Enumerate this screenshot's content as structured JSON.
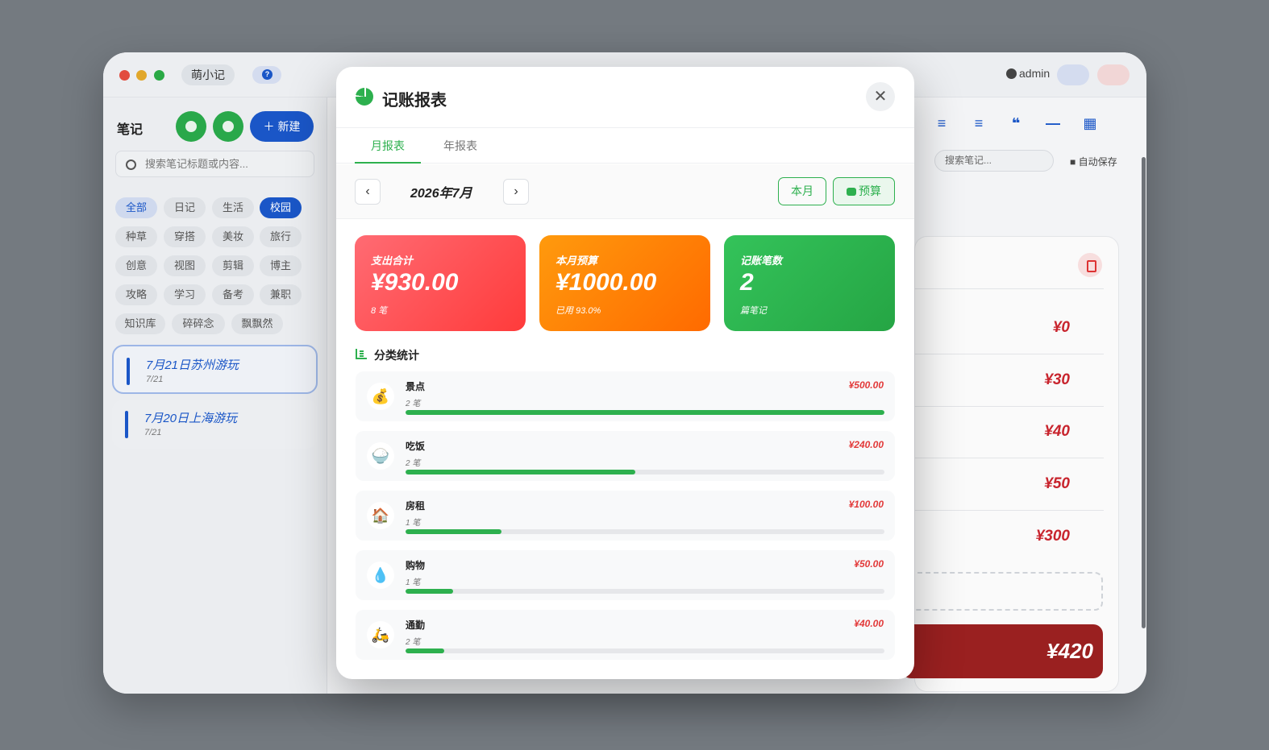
{
  "app": {
    "title": "萌小记",
    "help_icon": "help-icon",
    "user": "admin",
    "colors": {
      "primary": "#1a56c7",
      "green": "#2db04e",
      "red": "#c8242d"
    }
  },
  "sidebar": {
    "title": "笔记",
    "new_label": "新建",
    "search_placeholder": "搜索笔记标题或内容...",
    "tags": [
      "全部",
      "日记",
      "生活",
      "校园",
      "种草",
      "穿搭",
      "美妆",
      "旅行",
      "创意",
      "视图",
      "剪辑",
      "博主",
      "攻略",
      "学习",
      "备考",
      "兼职",
      "知识库",
      "碎碎念",
      "飘飘然"
    ],
    "notes": [
      {
        "title": "7月21日苏州游玩",
        "date": "7/21"
      },
      {
        "title": "7月20日上海游玩",
        "date": "7/21"
      }
    ]
  },
  "editor": {
    "search_placeholder": "搜索笔记...",
    "autosave": "自动保存",
    "amounts": [
      "¥0",
      "¥30",
      "¥40",
      "¥50",
      "¥300"
    ],
    "total": "¥420"
  },
  "modal": {
    "title": "记账报表",
    "tabs": [
      "月报表",
      "年报表"
    ],
    "month": "2026年7月",
    "this_month_label": "本月",
    "budget_label": "预算",
    "cards": {
      "expense": {
        "label": "支出合计",
        "value": "¥930.00",
        "sub": "8 笔"
      },
      "budget": {
        "label": "本月预算",
        "value": "¥1000.00",
        "sub": "已用 93.0%",
        "used_percent": 93.0
      },
      "count": {
        "label": "记账笔数",
        "value": "2",
        "sub": "篇笔记"
      }
    },
    "section_title": "分类统计",
    "categories": [
      {
        "name": "景点",
        "count": "2 笔",
        "amount": "¥500.00",
        "share": 1.0,
        "icon": "money-bag-icon",
        "glyph": "💰"
      },
      {
        "name": "吃饭",
        "count": "2 笔",
        "amount": "¥240.00",
        "share": 0.48,
        "icon": "rice-bowl-icon",
        "glyph": "🍚"
      },
      {
        "name": "房租",
        "count": "1 笔",
        "amount": "¥100.00",
        "share": 0.2,
        "icon": "house-icon",
        "glyph": "🏠"
      },
      {
        "name": "购物",
        "count": "1 笔",
        "amount": "¥50.00",
        "share": 0.1,
        "icon": "droplet-icon",
        "glyph": "💧"
      },
      {
        "name": "通勤",
        "count": "2 笔",
        "amount": "¥40.00",
        "share": 0.08,
        "icon": "scooter-icon",
        "glyph": "🛵"
      }
    ]
  }
}
